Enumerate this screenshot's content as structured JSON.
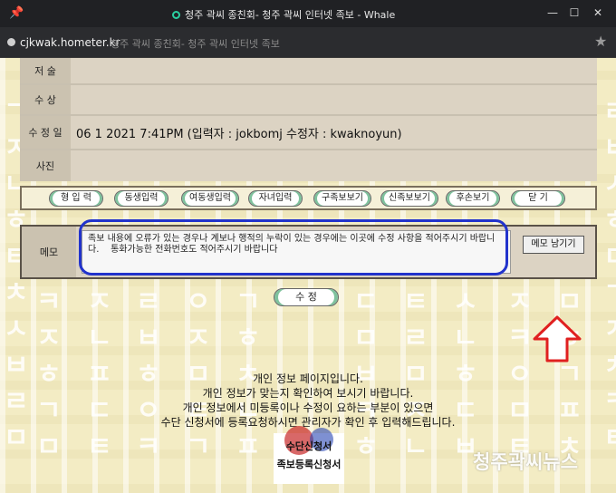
{
  "window": {
    "title": "청주 곽씨 종친회- 청주 곽씨 인터넷 족보 - Whale",
    "controls": [
      "—",
      "☐",
      "✕"
    ]
  },
  "address": {
    "url": "cjkwak.hometer.kr",
    "page_title": "청주 곽씨 종친회- 청주 곽씨 인터넷 족보"
  },
  "info_rows": [
    {
      "label": "저 술",
      "value": ""
    },
    {
      "label": "수 상",
      "value": ""
    },
    {
      "label": "수 정 일",
      "value": "06 1 2021 7:41PM (입력자 : jokbomj 수정자 : kwaknoyun)"
    },
    {
      "label": "사진",
      "value": ""
    }
  ],
  "action_buttons": [
    "형 입 력",
    "동생입력",
    "여동생입력",
    "자녀입력",
    "구족보보기",
    "신족보보기",
    "후손보기",
    "닫    기"
  ],
  "memo": {
    "label": "메모",
    "text": "족보 내용에 오류가 있는 경우나 계보나 행적의 누락이 있는 경우에는 이곳에 수정 사항을 적어주시기 바랍니다.    통화가능한 전화번호도 적어주시기 바랍니다",
    "button": "메모 남기기"
  },
  "submit_button": "수      정",
  "notice_lines": [
    "개인 정보 페이지입니다.",
    "개인 정보가 맞는지 확인하여 보시기 바랍니다.",
    "개인 정보에서 미등록이나 수정이 요하는 부분이 있으면",
    "수단 신청서에 등록요청하시면 관리자가 확인 후 입력해드립니다."
  ],
  "stamp": {
    "line1": "수단신청서",
    "line2": "족보등록신청서"
  },
  "watermark": "청주곽씨뉴스",
  "colors": {
    "highlight": "#2233cc",
    "arrow": "#e02020",
    "page_bg": "#f3ecc4"
  }
}
